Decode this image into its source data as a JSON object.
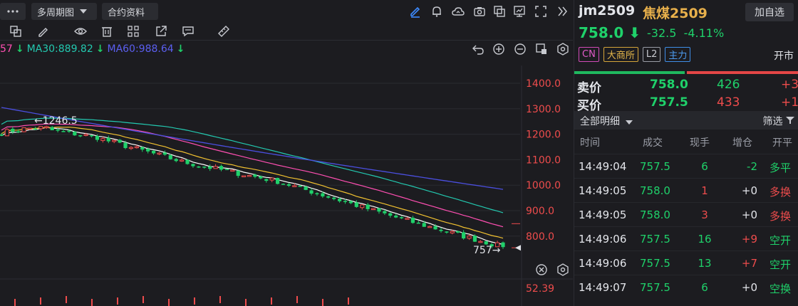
{
  "toolbar": {
    "period_label": "多周期图",
    "contract_label": "合约资料",
    "icons": [
      "menu-icon",
      "draw-icon",
      "bell-icon",
      "cloud-icon",
      "camera-icon",
      "copy-icon",
      "monitor-icon",
      "fullscreen-icon",
      "collapse-icon"
    ]
  },
  "drawing_tools": [
    "layers-icon",
    "pen-icon",
    "eye-icon",
    "trash-icon",
    "grid-icon",
    "export-icon",
    "comment-icon",
    "ruler-icon"
  ],
  "indicators": {
    "ma_prev_tail": "57",
    "ma30": "MA30:889.82",
    "ma60": "MA60:988.64"
  },
  "chart_data": {
    "type": "candlestick",
    "y_ticks": [
      "1400.0",
      "1300.0",
      "1200.0",
      "1100.0",
      "1000.0",
      "900.0",
      "800.0"
    ],
    "high_marker": "←1246.5",
    "low_marker": "757→",
    "lower_pane_value": "52.39",
    "ma_colors": {
      "ma5": "#ffffff",
      "ma10": "#f2c230",
      "ma20": "#ff4fb2",
      "ma30": "#23c9b0",
      "ma60": "#4b4fe0"
    }
  },
  "quote": {
    "code": "jm2509",
    "name": "焦煤2509",
    "watch_label": "加自选",
    "price": "758.0",
    "change": "-32.5",
    "change_pct": "-4.11%",
    "tags": [
      "CN",
      "大商所",
      "L2",
      "主力"
    ],
    "open_label": "开市"
  },
  "orderbook": {
    "sell": {
      "label": "卖价",
      "price": "758.0",
      "vol": "426",
      "chg": "+3"
    },
    "buy": {
      "label": "买价",
      "price": "757.5",
      "vol": "433",
      "chg": "+1"
    }
  },
  "details": {
    "title": "全部明细",
    "filter": "筛选",
    "columns": [
      "时间",
      "成交",
      "现手",
      "增仓",
      "开平"
    ],
    "rows": [
      {
        "time": "14:49:04",
        "price": "757.5",
        "hand": "6",
        "oi": "-2",
        "type": "多平",
        "hc": "g",
        "oc": "g",
        "tc": "g",
        "pc": "g"
      },
      {
        "time": "14:49:05",
        "price": "758.0",
        "hand": "1",
        "oi": "+0",
        "type": "多换",
        "hc": "r",
        "oc": "w",
        "tc": "r",
        "pc": "g"
      },
      {
        "time": "14:49:05",
        "price": "758.0",
        "hand": "3",
        "oi": "+0",
        "type": "多换",
        "hc": "r",
        "oc": "w",
        "tc": "r",
        "pc": "g"
      },
      {
        "time": "14:49:06",
        "price": "757.5",
        "hand": "16",
        "oi": "+9",
        "type": "空开",
        "hc": "g",
        "oc": "r",
        "tc": "g",
        "pc": "g"
      },
      {
        "time": "14:49:06",
        "price": "757.5",
        "hand": "13",
        "oi": "+7",
        "type": "空开",
        "hc": "g",
        "oc": "r",
        "tc": "g",
        "pc": "g"
      },
      {
        "time": "14:49:07",
        "price": "757.5",
        "hand": "6",
        "oi": "+0",
        "type": "空换",
        "hc": "g",
        "oc": "w",
        "tc": "g",
        "pc": "g"
      }
    ]
  }
}
